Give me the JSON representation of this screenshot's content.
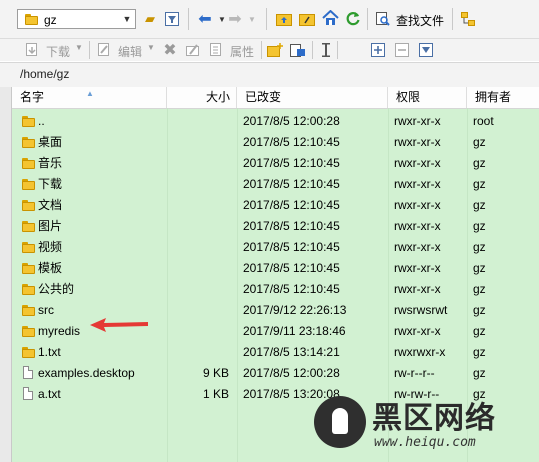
{
  "toolbar": {
    "location_value": "gz",
    "find_files_label": "查找文件",
    "download_label": "下载",
    "edit_label": "编辑",
    "properties_label": "属性"
  },
  "path": "/home/gz",
  "columns": {
    "name": "名字",
    "size": "大小",
    "modified": "已改变",
    "permissions": "权限",
    "owner": "拥有者"
  },
  "files": [
    {
      "name": "..",
      "size": "",
      "modified": "2017/8/5 12:00:28",
      "permissions": "rwxr-xr-x",
      "owner": "root",
      "type": "up"
    },
    {
      "name": "桌面",
      "size": "",
      "modified": "2017/8/5 12:10:45",
      "permissions": "rwxr-xr-x",
      "owner": "gz",
      "type": "folder"
    },
    {
      "name": "音乐",
      "size": "",
      "modified": "2017/8/5 12:10:45",
      "permissions": "rwxr-xr-x",
      "owner": "gz",
      "type": "folder"
    },
    {
      "name": "下载",
      "size": "",
      "modified": "2017/8/5 12:10:45",
      "permissions": "rwxr-xr-x",
      "owner": "gz",
      "type": "folder"
    },
    {
      "name": "文档",
      "size": "",
      "modified": "2017/8/5 12:10:45",
      "permissions": "rwxr-xr-x",
      "owner": "gz",
      "type": "folder"
    },
    {
      "name": "图片",
      "size": "",
      "modified": "2017/8/5 12:10:45",
      "permissions": "rwxr-xr-x",
      "owner": "gz",
      "type": "folder"
    },
    {
      "name": "视频",
      "size": "",
      "modified": "2017/8/5 12:10:45",
      "permissions": "rwxr-xr-x",
      "owner": "gz",
      "type": "folder"
    },
    {
      "name": "模板",
      "size": "",
      "modified": "2017/8/5 12:10:45",
      "permissions": "rwxr-xr-x",
      "owner": "gz",
      "type": "folder"
    },
    {
      "name": "公共的",
      "size": "",
      "modified": "2017/8/5 12:10:45",
      "permissions": "rwxr-xr-x",
      "owner": "gz",
      "type": "folder"
    },
    {
      "name": "src",
      "size": "",
      "modified": "2017/9/12 22:26:13",
      "permissions": "rwsrwsrwt",
      "owner": "gz",
      "type": "folder"
    },
    {
      "name": "myredis",
      "size": "",
      "modified": "2017/9/11 23:18:46",
      "permissions": "rwxr-xr-x",
      "owner": "gz",
      "type": "folder"
    },
    {
      "name": "1.txt",
      "size": "",
      "modified": "2017/8/5 13:14:21",
      "permissions": "rwxrwxr-x",
      "owner": "gz",
      "type": "folder"
    },
    {
      "name": "examples.desktop",
      "size": "9 KB",
      "modified": "2017/8/5 12:00:28",
      "permissions": "rw-r--r--",
      "owner": "gz",
      "type": "file"
    },
    {
      "name": "a.txt",
      "size": "1 KB",
      "modified": "2017/8/5 13:20:08",
      "permissions": "rw-rw-r--",
      "owner": "gz",
      "type": "file"
    }
  ],
  "watermark": {
    "title": "黑区网络",
    "url": "www.heiqu.com"
  },
  "colors": {
    "list_background": "#d2f1d2",
    "folder": "#f4c430",
    "annotation_arrow": "#e53935"
  }
}
